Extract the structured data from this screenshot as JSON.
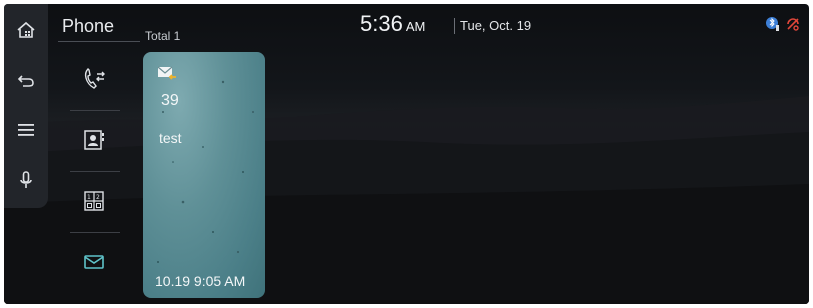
{
  "app": {
    "title": "Phone",
    "total_label": "Total 1"
  },
  "clock": {
    "time": "5:36",
    "ampm": "AM",
    "date": "Tue, Oct. 19"
  },
  "side_rail": {
    "items": [
      "home-icon",
      "back-icon",
      "menu-icon",
      "microphone-icon"
    ]
  },
  "phone_menu": {
    "items": [
      "call-history-icon",
      "contacts-icon",
      "keypad-icon",
      "messages-icon"
    ],
    "selected": "messages-icon"
  },
  "message_card": {
    "count": "39",
    "title": "test",
    "datetime": "10.19 9:05 AM",
    "icon": "new-message-icon"
  },
  "status_icons": [
    "bluetooth-phone-icon",
    "no-signal-icon"
  ],
  "colors": {
    "accent": "#5fc3c9",
    "card": "#5f9097",
    "status_red": "#e0463a",
    "status_blue": "#3d7fd6"
  }
}
